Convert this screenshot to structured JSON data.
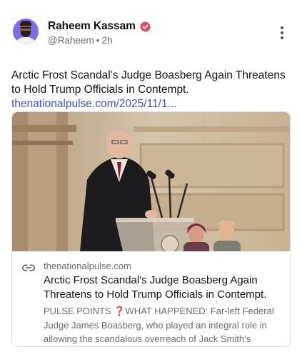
{
  "post": {
    "author_name": "Raheem Kassam",
    "handle": "@Raheem",
    "separator": "•",
    "time": "2h",
    "text": "Arctic Frost Scandal’s Judge Boasberg Again Threatens to Hold Trump Officials in Contempt.",
    "link_text": "thenationalpulse.com/2025/11/1..."
  },
  "card": {
    "domain": "thenationalpulse.com",
    "title": "Arctic Frost Scandal's Judge Boasberg Again Threatens to Hold Trump Officials in Contempt.",
    "description": "PULSE POINTS ❓WHAT HAPPENED: Far-left Federal Judge James Boasberg, who played an integral role in allowing the scandalous overreach of Jack Smith's"
  },
  "icons": {
    "avatar": "avatar",
    "verified": "verified-badge-icon",
    "more": "more-vertical-icon",
    "link": "link-icon"
  },
  "colors": {
    "accent_link": "#3b50d4",
    "verified_badge": "#e8465f",
    "secondary_text": "#6b6b6b"
  }
}
